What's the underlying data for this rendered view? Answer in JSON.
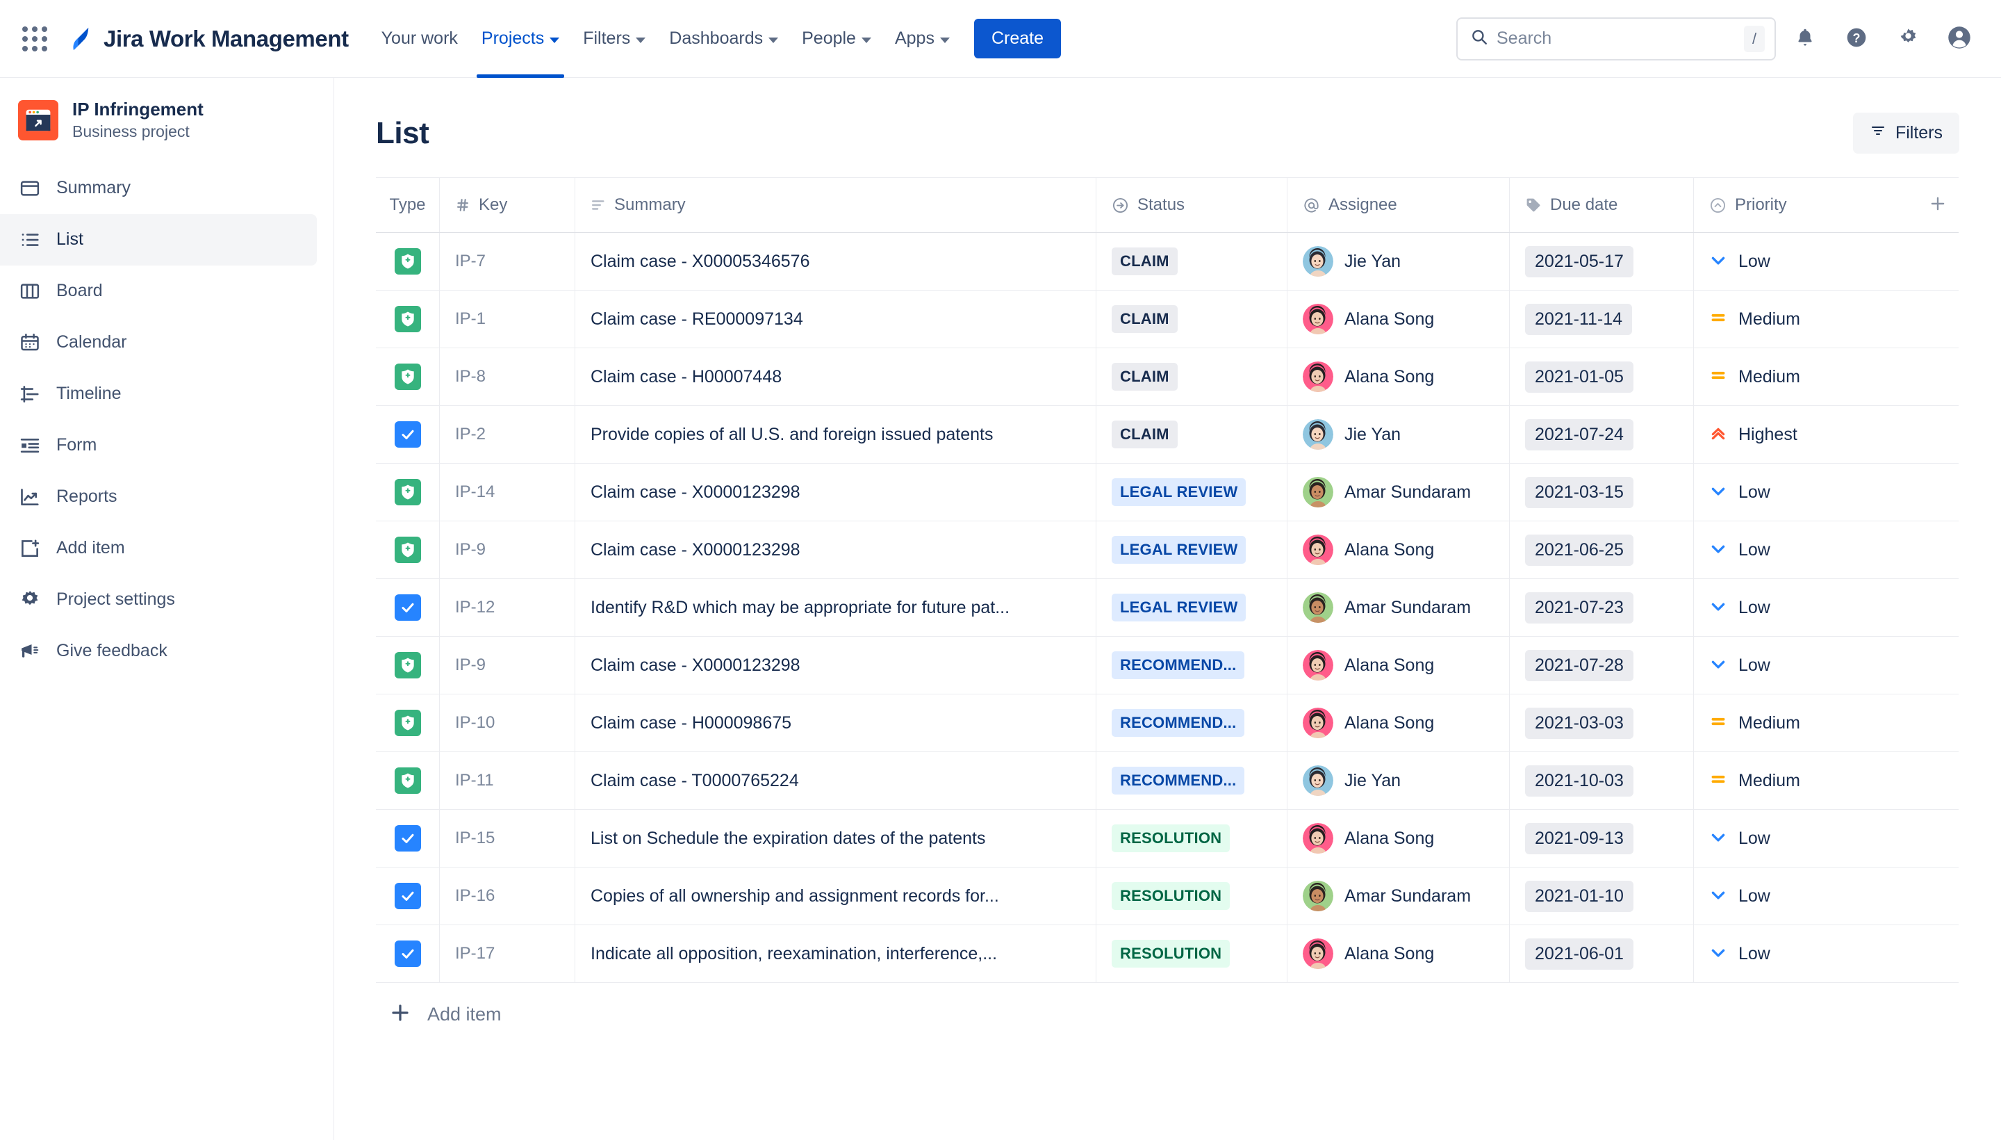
{
  "topnav": {
    "app_switcher_icon": "grid-apps-icon",
    "brand": "Jira Work Management",
    "items": [
      {
        "label": "Your work",
        "has_caret": false,
        "active": false
      },
      {
        "label": "Projects",
        "has_caret": true,
        "active": true
      },
      {
        "label": "Filters",
        "has_caret": true,
        "active": false
      },
      {
        "label": "Dashboards",
        "has_caret": true,
        "active": false
      },
      {
        "label": "People",
        "has_caret": true,
        "active": false
      },
      {
        "label": "Apps",
        "has_caret": true,
        "active": false
      }
    ],
    "create_label": "Create",
    "search": {
      "placeholder": "Search",
      "shortcut": "/",
      "icon": "search-icon"
    },
    "right_icons": [
      "notifications-bell-icon",
      "help-question-icon",
      "settings-gear-icon",
      "user-avatar-icon"
    ],
    "accent": "#0052cc"
  },
  "sidebar": {
    "project": {
      "name": "IP Infringement",
      "type": "Business project",
      "avatar_icon": "project-browser-icon",
      "avatar_color": "#ff5630"
    },
    "items": [
      {
        "label": "Summary",
        "icon": "summary-icon",
        "selected": false
      },
      {
        "label": "List",
        "icon": "list-icon",
        "selected": true
      },
      {
        "label": "Board",
        "icon": "board-columns-icon",
        "selected": false
      },
      {
        "label": "Calendar",
        "icon": "calendar-icon",
        "selected": false
      },
      {
        "label": "Timeline",
        "icon": "timeline-icon",
        "selected": false
      },
      {
        "label": "Form",
        "icon": "form-icon",
        "selected": false
      },
      {
        "label": "Reports",
        "icon": "reports-chart-icon",
        "selected": false
      },
      {
        "label": "Add item",
        "icon": "add-item-icon",
        "selected": false
      },
      {
        "label": "Project settings",
        "icon": "settings-gear-icon",
        "selected": false
      },
      {
        "label": "Give feedback",
        "icon": "megaphone-icon",
        "selected": false
      }
    ]
  },
  "main": {
    "title": "List",
    "filters_label": "Filters",
    "filters_icon": "filter-icon",
    "add_column_icon": "plus-icon",
    "add_item_label": "Add item",
    "add_item_icon": "plus-icon"
  },
  "table": {
    "columns": [
      {
        "key": "type",
        "label": "Type",
        "icon": null
      },
      {
        "key": "key",
        "label": "Key",
        "icon": "hash-icon"
      },
      {
        "key": "summary",
        "label": "Summary",
        "icon": "lines-icon"
      },
      {
        "key": "status",
        "label": "Status",
        "icon": "arrow-circle-right-icon"
      },
      {
        "key": "assignee",
        "label": "Assignee",
        "icon": "at-sign-icon"
      },
      {
        "key": "due_date",
        "label": "Due date",
        "icon": "tag-icon"
      },
      {
        "key": "priority",
        "label": "Priority",
        "icon": "chevron-circle-up-icon"
      }
    ],
    "rows": [
      {
        "type": "claim",
        "key": "IP-7",
        "summary": "Claim case - X00005346576",
        "status": "CLAIM",
        "status_tone": "gray",
        "assignee": "Jie Yan",
        "avatar": "jie-yan",
        "due_date": "2021-05-17",
        "priority": "Low",
        "priority_icon": "chevron-down-icon"
      },
      {
        "type": "claim",
        "key": "IP-1",
        "summary": "Claim case - RE000097134",
        "status": "CLAIM",
        "status_tone": "gray",
        "assignee": "Alana Song",
        "avatar": "alana-song",
        "due_date": "2021-11-14",
        "priority": "Medium",
        "priority_icon": "equals-icon"
      },
      {
        "type": "claim",
        "key": "IP-8",
        "summary": "Claim case - H00007448",
        "status": "CLAIM",
        "status_tone": "gray",
        "assignee": "Alana Song",
        "avatar": "alana-song",
        "due_date": "2021-01-05",
        "priority": "Medium",
        "priority_icon": "equals-icon"
      },
      {
        "type": "task",
        "key": "IP-2",
        "summary": "Provide copies of all U.S. and foreign issued patents",
        "status": "CLAIM",
        "status_tone": "gray",
        "assignee": "Jie Yan",
        "avatar": "jie-yan",
        "due_date": "2021-07-24",
        "priority": "Highest",
        "priority_icon": "double-chevron-up-icon"
      },
      {
        "type": "claim",
        "key": "IP-14",
        "summary": "Claim case - X0000123298",
        "status": "LEGAL REVIEW",
        "status_tone": "blue",
        "assignee": "Amar Sundaram",
        "avatar": "amar-sundaram",
        "due_date": "2021-03-15",
        "priority": "Low",
        "priority_icon": "chevron-down-icon"
      },
      {
        "type": "claim",
        "key": "IP-9",
        "summary": "Claim case - X0000123298",
        "status": "LEGAL REVIEW",
        "status_tone": "blue",
        "assignee": "Alana Song",
        "avatar": "alana-song",
        "due_date": "2021-06-25",
        "priority": "Low",
        "priority_icon": "chevron-down-icon"
      },
      {
        "type": "task",
        "key": "IP-12",
        "summary": "Identify R&D which may be appropriate for future pat...",
        "status": "LEGAL REVIEW",
        "status_tone": "blue",
        "assignee": "Amar Sundaram",
        "avatar": "amar-sundaram",
        "due_date": "2021-07-23",
        "priority": "Low",
        "priority_icon": "chevron-down-icon"
      },
      {
        "type": "claim",
        "key": "IP-9",
        "summary": "Claim case - X0000123298",
        "status": "RECOMMEND...",
        "status_tone": "blue",
        "assignee": "Alana Song",
        "avatar": "alana-song",
        "due_date": "2021-07-28",
        "priority": "Low",
        "priority_icon": "chevron-down-icon"
      },
      {
        "type": "claim",
        "key": "IP-10",
        "summary": "Claim case - H000098675",
        "status": "RECOMMEND...",
        "status_tone": "blue",
        "assignee": "Alana Song",
        "avatar": "alana-song",
        "due_date": "2021-03-03",
        "priority": "Medium",
        "priority_icon": "equals-icon"
      },
      {
        "type": "claim",
        "key": "IP-11",
        "summary": "Claim case - T0000765224",
        "status": "RECOMMEND...",
        "status_tone": "blue",
        "assignee": "Jie Yan",
        "avatar": "jie-yan",
        "due_date": "2021-10-03",
        "priority": "Medium",
        "priority_icon": "equals-icon"
      },
      {
        "type": "task",
        "key": "IP-15",
        "summary": "List on Schedule the expiration dates of the patents",
        "status": "RESOLUTION",
        "status_tone": "green",
        "assignee": "Alana Song",
        "avatar": "alana-song",
        "due_date": "2021-09-13",
        "priority": "Low",
        "priority_icon": "chevron-down-icon"
      },
      {
        "type": "task",
        "key": "IP-16",
        "summary": "Copies of all ownership and assignment records for...",
        "status": "RESOLUTION",
        "status_tone": "green",
        "assignee": "Amar Sundaram",
        "avatar": "amar-sundaram",
        "due_date": "2021-01-10",
        "priority": "Low",
        "priority_icon": "chevron-down-icon"
      },
      {
        "type": "task",
        "key": "IP-17",
        "summary": "Indicate all opposition, reexamination, interference,...",
        "status": "RESOLUTION",
        "status_tone": "green",
        "assignee": "Alana Song",
        "avatar": "alana-song",
        "due_date": "2021-06-01",
        "priority": "Low",
        "priority_icon": "chevron-down-icon"
      }
    ]
  },
  "colors": {
    "brand_blue": "#0052cc",
    "create_blue": "#0c57cf",
    "task_blue": "#2684ff",
    "claim_green": "#36b37e",
    "priority_low": "#2684ff",
    "priority_medium": "#ffab00",
    "priority_highest": "#ff5630",
    "project_red": "#ff5630",
    "text_dark": "#172b4d",
    "text_muted": "#5e6c84"
  }
}
